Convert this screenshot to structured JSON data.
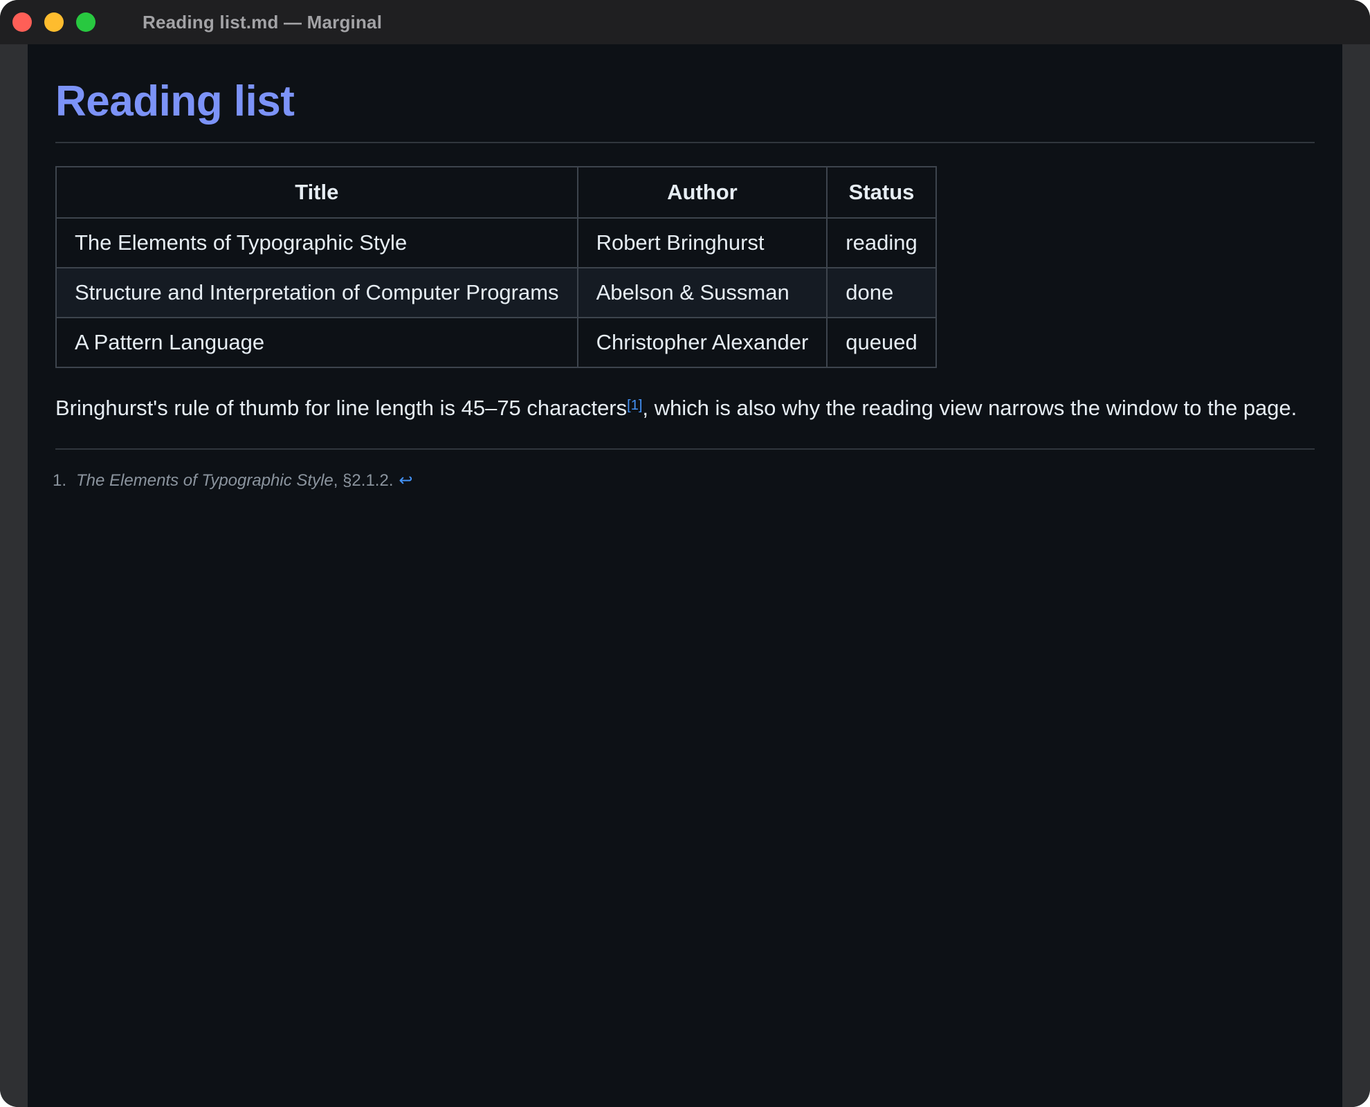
{
  "window": {
    "title": "Reading list.md — Marginal",
    "traffic_lights": {
      "close_color": "#ff5f57",
      "minimize_color": "#febc2e",
      "zoom_color": "#28c840"
    }
  },
  "document": {
    "heading": "Reading list",
    "heading_color": "#7c93f8",
    "link_color": "#4493f8",
    "table": {
      "headers": [
        "Title",
        "Author",
        "Status"
      ],
      "rows": [
        [
          "The Elements of Typographic Style",
          "Robert Bringhurst",
          "reading"
        ],
        [
          "Structure and Interpretation of Computer Programs",
          "Abelson & Sussman",
          "done"
        ],
        [
          "A Pattern Language",
          "Christopher Alexander",
          "queued"
        ]
      ]
    },
    "paragraph": {
      "before": "Bringhurst's rule of thumb for line length is 45–75 characters",
      "footnote_ref": "[1]",
      "after": ", which is also why the reading view narrows the window to the page."
    },
    "footnotes": [
      {
        "number": "1.",
        "title": "The Elements of Typographic Style",
        "rest": ", §2.1.2.",
        "backref_icon": "return-arrow-icon",
        "backref_glyph": "↩"
      }
    ]
  }
}
